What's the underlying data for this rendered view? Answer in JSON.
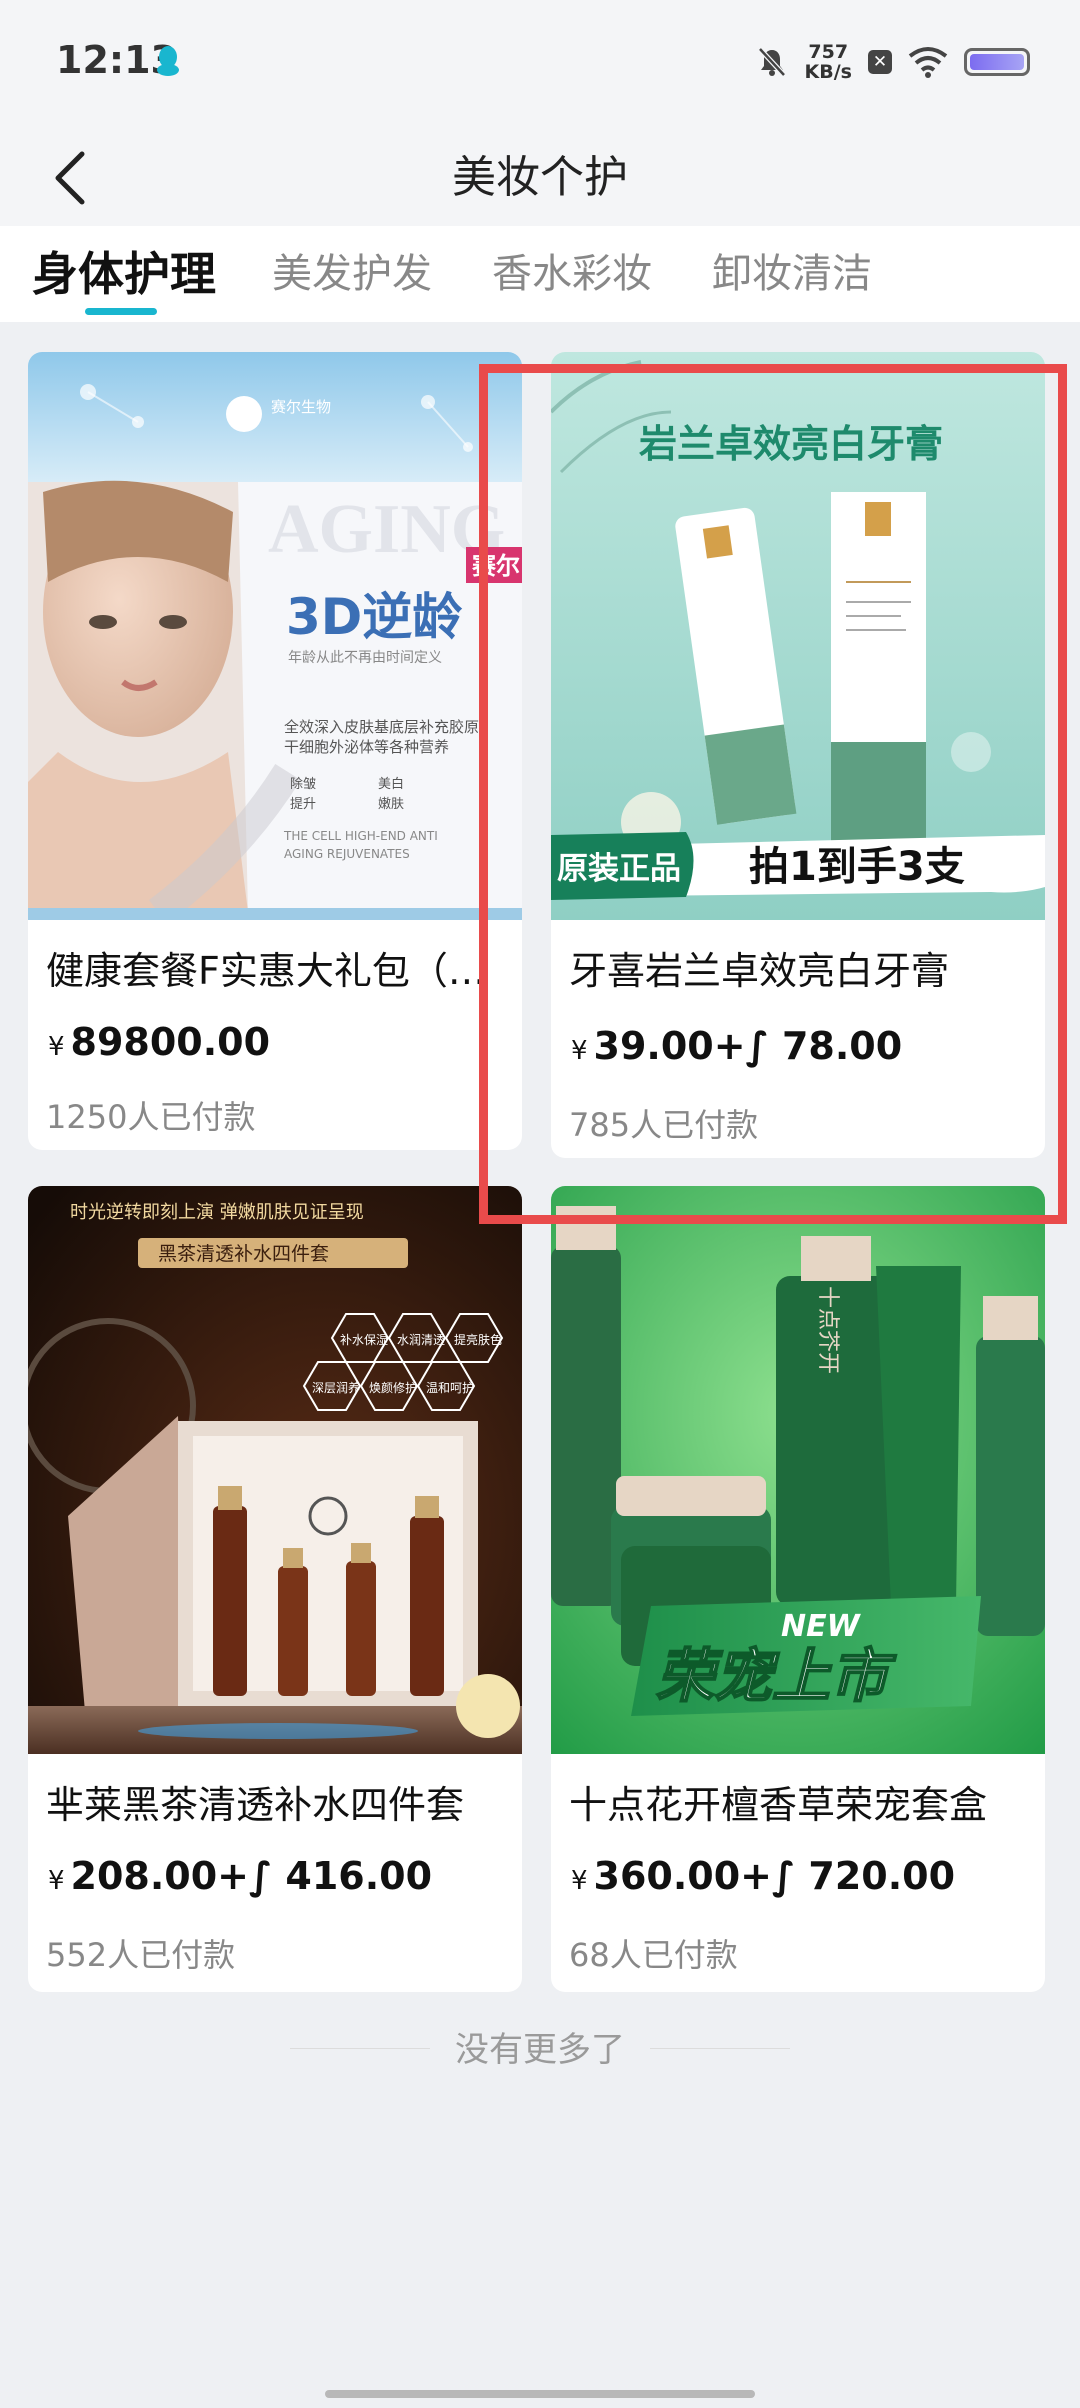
{
  "status_bar": {
    "time": "12:13",
    "net_speed_value": "757",
    "net_speed_unit": "KB/s"
  },
  "header": {
    "title": "美妆个护"
  },
  "tabs": [
    {
      "label": "身体护理",
      "active": true
    },
    {
      "label": "美发护发",
      "active": false
    },
    {
      "label": "香水彩妆",
      "active": false
    },
    {
      "label": "卸妆清洁",
      "active": false
    }
  ],
  "products": [
    {
      "title": "健康套餐F实惠大礼包（…",
      "currency": "¥",
      "price": "89800.00",
      "sold": "1250人已付款",
      "image": {
        "brand": "赛尔生物",
        "badge": "赛尔",
        "headline": "3D逆龄",
        "subline": "年龄从此不再由时间定义",
        "ghost_text": "AGING",
        "desc1": "全效深入皮肤基底层补充胶原",
        "desc2": "干细胞外泌体等各种营养",
        "checks": [
          "除皱",
          "美白",
          "提升",
          "嫩肤"
        ],
        "en1": "THE CELL HIGH-END ANTI",
        "en2": "AGING REJUVENATES"
      }
    },
    {
      "title": "牙喜岩兰卓效亮白牙膏",
      "currency": "¥",
      "price": "39.00+∫ 78.00",
      "sold": "785人已付款",
      "image": {
        "headline": "岩兰卓效亮白牙膏",
        "tag": "原装正品",
        "promo": "拍1到手3支"
      }
    },
    {
      "title": "芈莱黑茶清透补水四件套",
      "currency": "¥",
      "price": "208.00+∫ 416.00",
      "sold": "552人已付款",
      "image": {
        "top_text": "时光逆转即刻上演  弹嫩肌肤见证呈现",
        "banner": "黑茶清透补水四件套",
        "hex": [
          "补水保湿",
          "水润清透",
          "提亮肤色",
          "深层润养",
          "焕颜修护",
          "温和呵护"
        ]
      }
    },
    {
      "title": "十点花开檀香草荣宠套盒",
      "currency": "¥",
      "price": "360.00+∫ 720.00",
      "sold": "68人已付款",
      "image": {
        "new_tag": "NEW",
        "slogan": "荣宠上市",
        "brand": "十点芥开"
      }
    }
  ],
  "footer": {
    "no_more": "没有更多了"
  },
  "colors": {
    "accent": "#19b6cf",
    "highlight": "#e94b4b",
    "page_bg": "#eef0f3"
  }
}
